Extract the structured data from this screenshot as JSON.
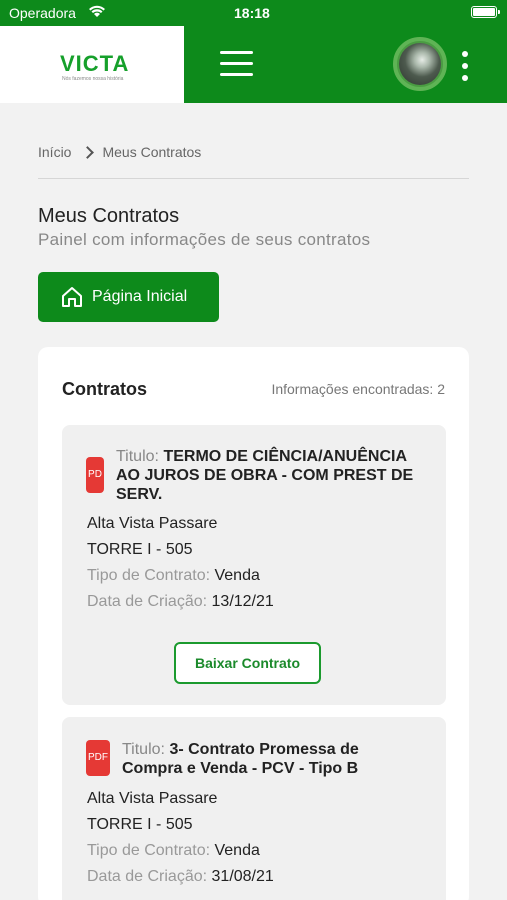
{
  "status_bar": {
    "carrier": "Operadora",
    "time": "18:18"
  },
  "header": {
    "logo": "VICTA",
    "logo_tagline": "Nós fazemos nossa história"
  },
  "breadcrumb": {
    "home": "Início",
    "current": "Meus Contratos"
  },
  "page": {
    "title": "Meus Contratos",
    "subtitle": "Painel com informações de seus contratos"
  },
  "home_button": {
    "label": "Página Inicial"
  },
  "contracts_card": {
    "title": "Contratos",
    "count_text": "Informações encontradas: 2"
  },
  "labels": {
    "titulo": "Titulo:",
    "tipo": "Tipo de Contrato:",
    "data": "Data de Criação:",
    "download": "Baixar Contrato"
  },
  "contracts": [
    {
      "icon_text": "PD",
      "title": "TERMO DE CIÊNCIA/ANUÊNCIA AO JUROS DE OBRA - COM PREST DE SERV.",
      "title_line1": "TERMO DE CIÊNCIA/ANUÊNCIA",
      "title_line2": "AO JUROS DE OBRA - COM PREST DE",
      "title_line3": "SERV.",
      "development": "Alta Vista Passare",
      "unit": "TORRE I - 505",
      "type": "Venda",
      "created": "13/12/21"
    },
    {
      "icon_text": "PDF",
      "title": "3- Contrato Promessa de Compra e Venda - PCV - Tipo B",
      "title_line1": "3- Contrato Promessa de",
      "title_line2": "Compra e Venda - PCV - Tipo B",
      "development": "Alta Vista Passare",
      "unit": "TORRE I - 505",
      "type": "Venda",
      "created": "31/08/21"
    }
  ],
  "colors": {
    "brand_green": "#0d8a1b",
    "pdf_red": "#e53935"
  }
}
